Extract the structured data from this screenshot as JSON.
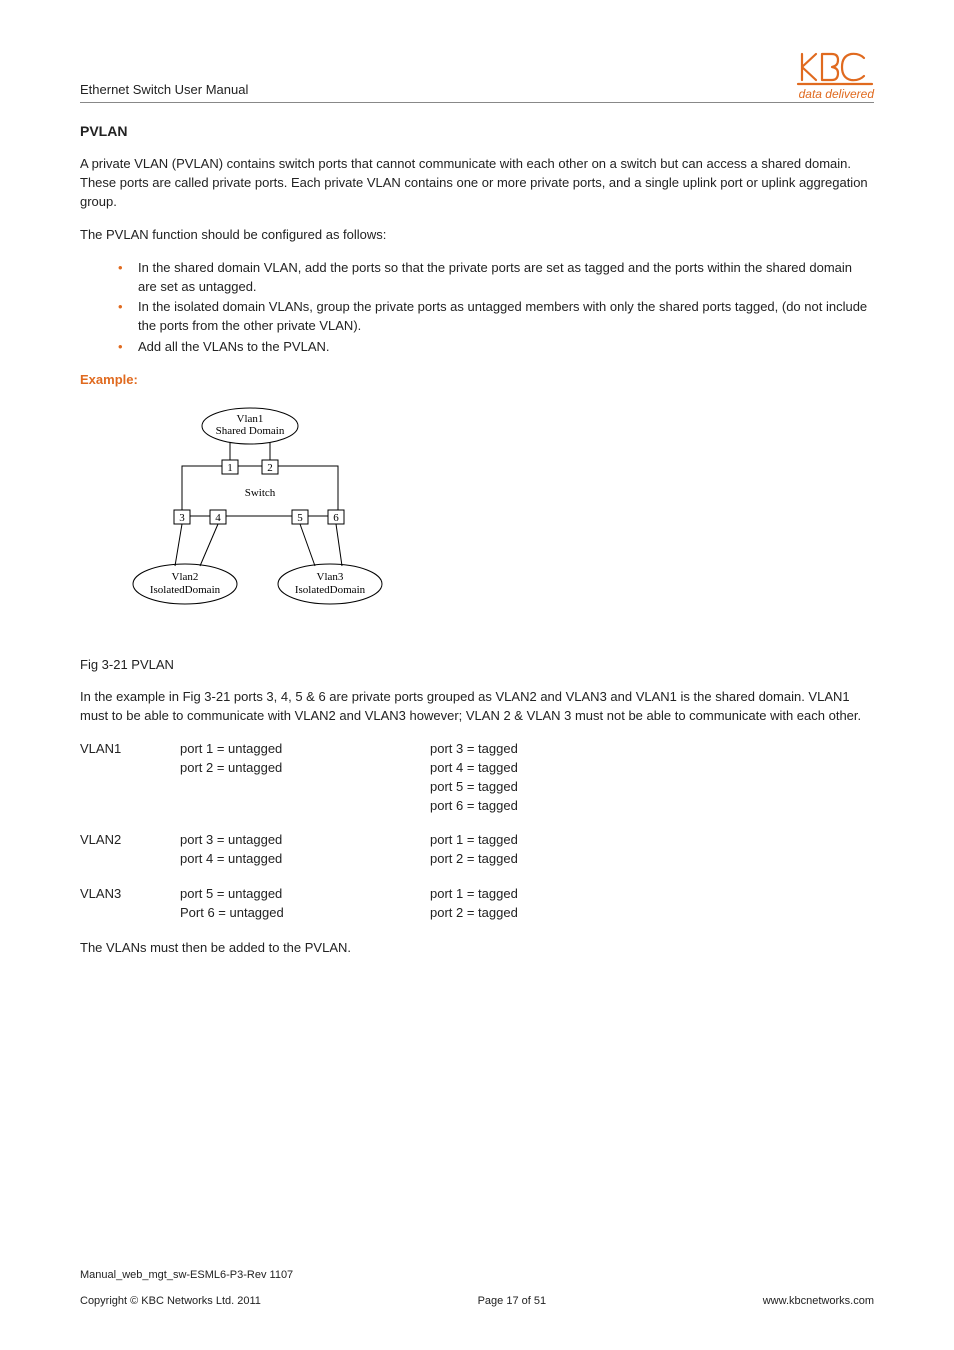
{
  "header": {
    "doc_title": "Ethernet Switch User Manual",
    "tagline": "data delivered"
  },
  "section": {
    "title": "PVLAN",
    "para1": "A private VLAN (PVLAN) contains switch ports that cannot communicate with each other on a switch but can access a shared domain. These ports are called private ports. Each private VLAN contains one or more private ports, and a single uplink port or uplink aggregation group.",
    "para2": "The PVLAN function should be configured as follows:",
    "bullets": [
      "In the shared domain VLAN, add the ports so that the private ports are set as tagged and the ports within the shared domain are set as untagged.",
      "In the isolated domain VLANs, group the private ports as untagged members with only the shared ports tagged, (do not include the ports from the other private VLAN).",
      "Add all the VLANs to the PVLAN."
    ],
    "example_label": "Example:"
  },
  "diagram": {
    "vlan1_line1": "Vlan1",
    "vlan1_line2": "Shared Domain",
    "switch_label": "Switch",
    "vlan2_line1": "Vlan2",
    "vlan2_line2": "IsolatedDomain",
    "vlan3_line1": "Vlan3",
    "vlan3_line2": "IsolatedDomain",
    "p1": "1",
    "p2": "2",
    "p3": "3",
    "p4": "4",
    "p5": "5",
    "p6": "6"
  },
  "fig_caption": "Fig 3-21 PVLAN",
  "para3": "In the example in Fig 3-21 ports 3, 4, 5 & 6 are private ports grouped as VLAN2 and VLAN3 and VLAN1 is the shared domain. VLAN1 must to be able to communicate with VLAN2 and VLAN3 however; VLAN 2 & VLAN 3 must not be able to communicate with each other.",
  "vlan_table": [
    {
      "name": "VLAN1",
      "left": [
        "port 1 = untagged",
        "port 2 = untagged"
      ],
      "right": [
        "port 3 = tagged",
        "port 4 = tagged",
        "port 5 = tagged",
        "port 6 = tagged"
      ]
    },
    {
      "name": "VLAN2",
      "left": [
        "port 3 = untagged",
        "port 4 = untagged"
      ],
      "right": [
        "port 1 = tagged",
        "port 2 = tagged"
      ]
    },
    {
      "name": "VLAN3",
      "left": [
        "port 5 = untagged",
        "Port 6 = untagged"
      ],
      "right": [
        "port 1 = tagged",
        "port 2 = tagged"
      ]
    }
  ],
  "para4": "The VLANs must then be added to the PVLAN.",
  "footer": {
    "filename": "Manual_web_mgt_sw-ESML6-P3-Rev 1107",
    "copyright": "Copyright © KBC Networks Ltd. 2011",
    "page": "Page 17 of 51",
    "url": "www.kbcnetworks.com"
  }
}
